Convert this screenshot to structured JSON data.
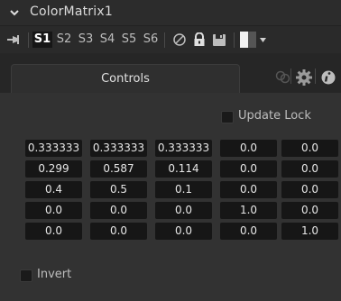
{
  "node": {
    "title": "ColorMatrix1"
  },
  "toolbar": {
    "slots": [
      "S1",
      "S2",
      "S3",
      "S4",
      "S5",
      "S6"
    ],
    "active_slot": "S1"
  },
  "tabs": [
    {
      "label": "Controls",
      "icon": null
    },
    {
      "label": "",
      "icon": "link-icon"
    },
    {
      "label": "",
      "icon": "gear-icon"
    },
    {
      "label": "",
      "icon": "info-icon"
    }
  ],
  "controls": {
    "update_lock": {
      "label": "Update Lock",
      "checked": false
    },
    "matrix": [
      [
        "0.333333",
        "0.333333",
        "0.333333",
        "0.0",
        "0.0"
      ],
      [
        "0.299",
        "0.587",
        "0.114",
        "0.0",
        "0.0"
      ],
      [
        "0.4",
        "0.5",
        "0.1",
        "0.0",
        "0.0"
      ],
      [
        "0.0",
        "0.0",
        "0.0",
        "1.0",
        "0.0"
      ],
      [
        "0.0",
        "0.0",
        "0.0",
        "0.0",
        "1.0"
      ]
    ],
    "invert": {
      "label": "Invert",
      "checked": false
    }
  },
  "colors": {
    "background": "#323232",
    "field": "#161616",
    "header": "#2c2c2c"
  }
}
